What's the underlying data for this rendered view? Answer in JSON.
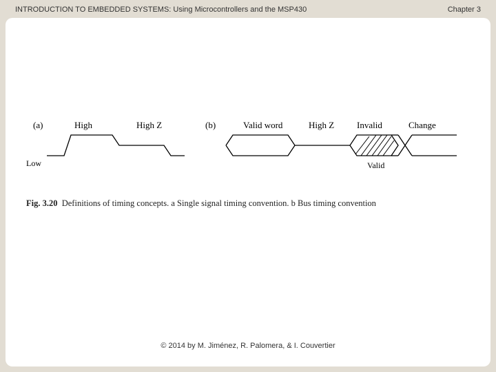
{
  "header": {
    "title": "INTRODUCTION TO EMBEDDED SYSTEMS: Using Microcontrollers and the MSP430",
    "chapter": "Chapter 3"
  },
  "figure": {
    "panel_a": {
      "label": "(a)",
      "high": "High",
      "highz": "High Z",
      "low": "Low"
    },
    "panel_b": {
      "label": "(b)",
      "validword": "Valid word",
      "highz": "High Z",
      "invalid": "Invalid",
      "change": "Change",
      "valid": "Valid"
    },
    "caption_no": "Fig. 3.20",
    "caption_text": "Definitions of timing concepts. a Single signal timing convention. b Bus timing convention"
  },
  "footer": {
    "copyright": "© 2014 by M. Jiménez, R. Palomera, & I. Couvertier"
  }
}
